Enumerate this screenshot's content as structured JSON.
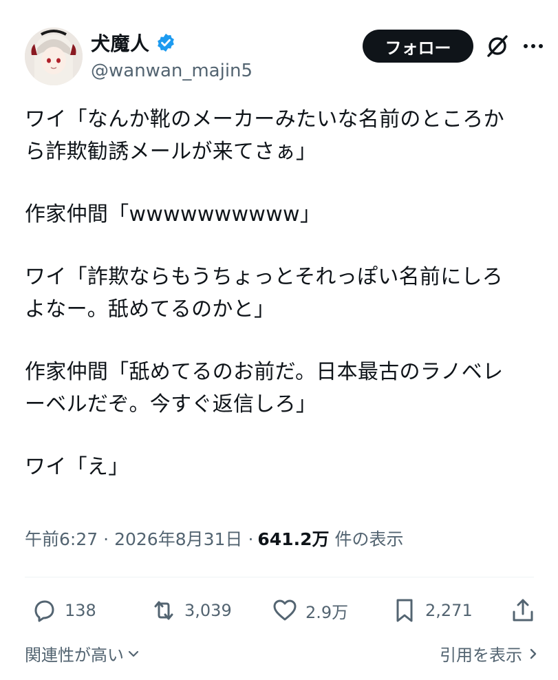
{
  "author": {
    "display_name": "犬魔人",
    "handle": "@wanwan_majin5",
    "verified": true
  },
  "header": {
    "follow_label": "フォロー"
  },
  "tweet": {
    "lines": [
      "ワイ「なんか靴のメーカーみたいな名前のところか",
      "ら詐欺勧誘メールが来てさぁ」",
      "",
      "作家仲間「wwwwwwwwww」",
      "",
      "ワイ「詐欺ならもうちょっとそれっぽい名前にしろ",
      "よなー。舐めてるのかと」",
      "",
      "作家仲間「舐めてるのお前だ。日本最古のラノベレ",
      "ーベルだぞ。今すぐ返信しろ」",
      "",
      "ワイ「え」"
    ]
  },
  "meta": {
    "time": "午前6:27",
    "sep": "·",
    "date": "2026年8月31日",
    "views_count": "641.2万",
    "views_label": "件の表示"
  },
  "actions": {
    "replies": "138",
    "reposts": "3,039",
    "likes": "2.9万",
    "bookmarks": "2,271"
  },
  "footer": {
    "sort_label": "関連性が高い",
    "quotes_label": "引用を表示"
  },
  "colors": {
    "text": "#0f1419",
    "secondary": "#536471",
    "verified": "#1d9bf0",
    "button_bg": "#0f1419"
  }
}
